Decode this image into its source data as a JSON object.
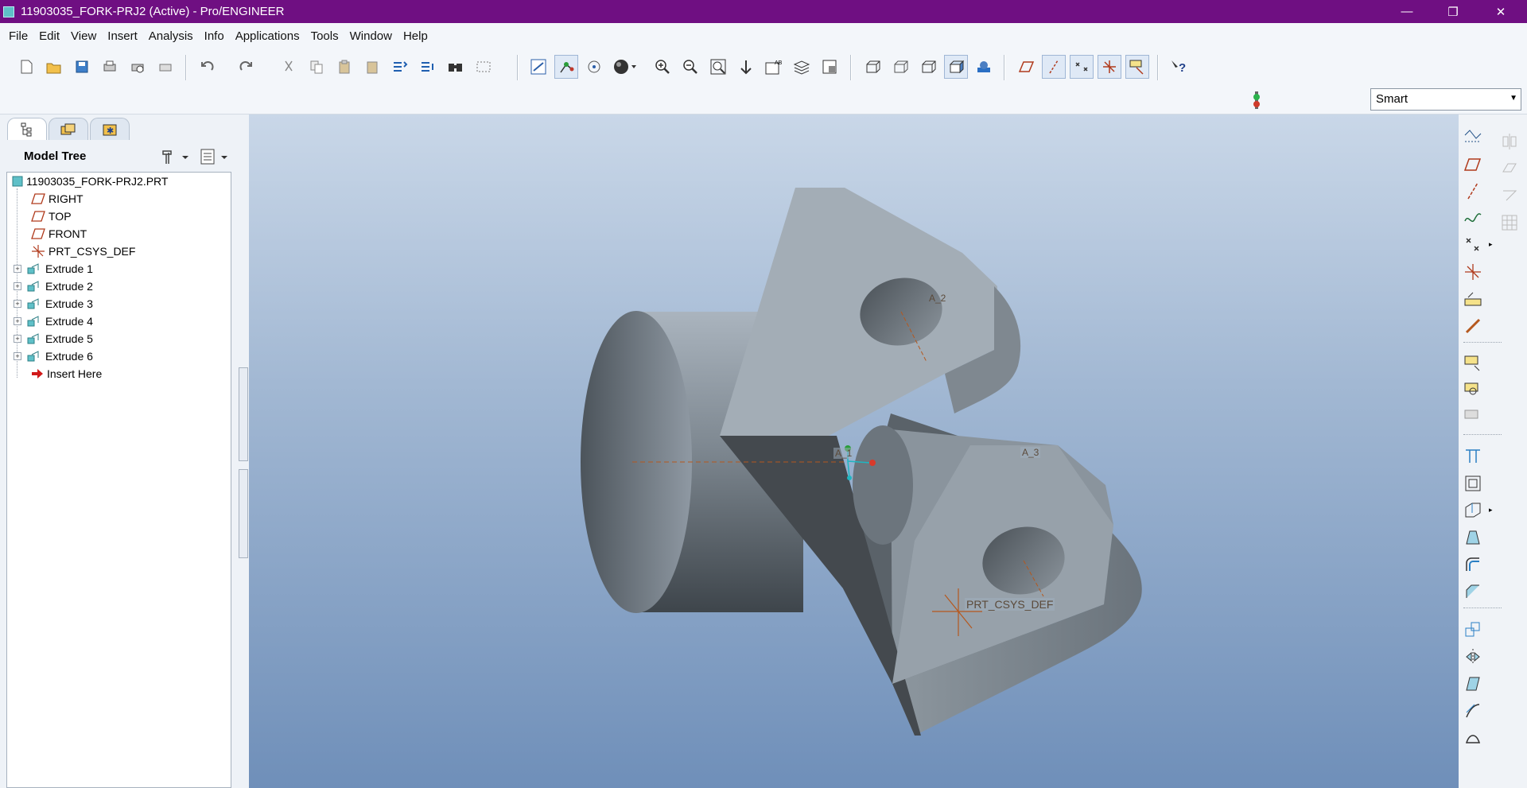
{
  "window": {
    "title": "11903035_FORK-PRJ2 (Active) - Pro/ENGINEER",
    "minimize_glyph": "—",
    "restore_glyph": "❐",
    "close_glyph": "✕"
  },
  "menu": [
    "File",
    "Edit",
    "View",
    "Insert",
    "Analysis",
    "Info",
    "Applications",
    "Tools",
    "Window",
    "Help"
  ],
  "toolbar": {
    "icons": [
      "new-icon",
      "open-icon",
      "save-icon",
      "print-icon",
      "print-preview-icon",
      "quick-print-icon",
      "undo-icon",
      "redo-icon",
      "cut-icon",
      "copy-icon",
      "paste-icon",
      "paste-special-icon",
      "regenerate-icon",
      "regeneration-manager-icon",
      "find-icon",
      "select-box-icon",
      "repaint-icon",
      "spin-center-icon",
      "orient-mode-icon",
      "appearance-icon",
      "zoom-in-icon",
      "zoom-out-icon",
      "refit-icon",
      "reorient-icon",
      "saved-views-icon",
      "layers-icon",
      "view-manager-icon",
      "wireframe-icon",
      "hidden-line-icon",
      "no-hidden-icon",
      "shading-icon",
      "enhanced-realism-icon",
      "datum-planes-icon",
      "datum-axes-icon",
      "datum-points-icon",
      "csys-icon",
      "annotations-icon",
      "context-help-icon"
    ]
  },
  "filter": {
    "value": "Smart"
  },
  "left_panel": {
    "tabs": [
      "model-tree-tab",
      "folder-browser-tab",
      "favorites-tab"
    ],
    "header": "Model Tree",
    "tree": [
      {
        "label": "11903035_FORK-PRJ2.PRT",
        "kind": "part"
      },
      {
        "label": "RIGHT",
        "kind": "plane"
      },
      {
        "label": "TOP",
        "kind": "plane"
      },
      {
        "label": "FRONT",
        "kind": "plane"
      },
      {
        "label": "PRT_CSYS_DEF",
        "kind": "csys"
      },
      {
        "label": "Extrude 1",
        "kind": "extrude"
      },
      {
        "label": "Extrude 2",
        "kind": "extrude"
      },
      {
        "label": "Extrude 3",
        "kind": "extrude"
      },
      {
        "label": "Extrude 4",
        "kind": "extrude"
      },
      {
        "label": "Extrude 5",
        "kind": "extrude"
      },
      {
        "label": "Extrude 6",
        "kind": "extrude"
      },
      {
        "label": "Insert Here",
        "kind": "insert"
      }
    ]
  },
  "viewport": {
    "labels": {
      "axis_a1": "A_1",
      "axis_a2": "A_2",
      "axis_a3": "A_3",
      "csys": "PRT_CSYS_DEF"
    }
  },
  "right_toolbar": {
    "icons": [
      "sketched-curve-icon",
      "datum-plane-tool-icon",
      "datum-axis-tool-icon",
      "datum-curve-icon",
      "datum-point-tool-icon",
      "csys-tool-icon",
      "analysis-feature-icon",
      "chain-icon",
      "extrude-tool-icon",
      "revolve-tool-icon",
      "variable-section-sweep-icon",
      "hole-tool-icon",
      "shell-tool-icon",
      "rib-tool-icon",
      "draft-tool-icon",
      "round-tool-icon",
      "chamfer-tool-icon",
      "pattern-tool-icon",
      "mirror-tool-icon",
      "merge-tool-icon",
      "trim-tool-icon",
      "boundary-blend-icon",
      "mirror-gray-icon",
      "merge-gray-icon",
      "intersect-gray-icon",
      "pattern-gray-icon"
    ]
  }
}
